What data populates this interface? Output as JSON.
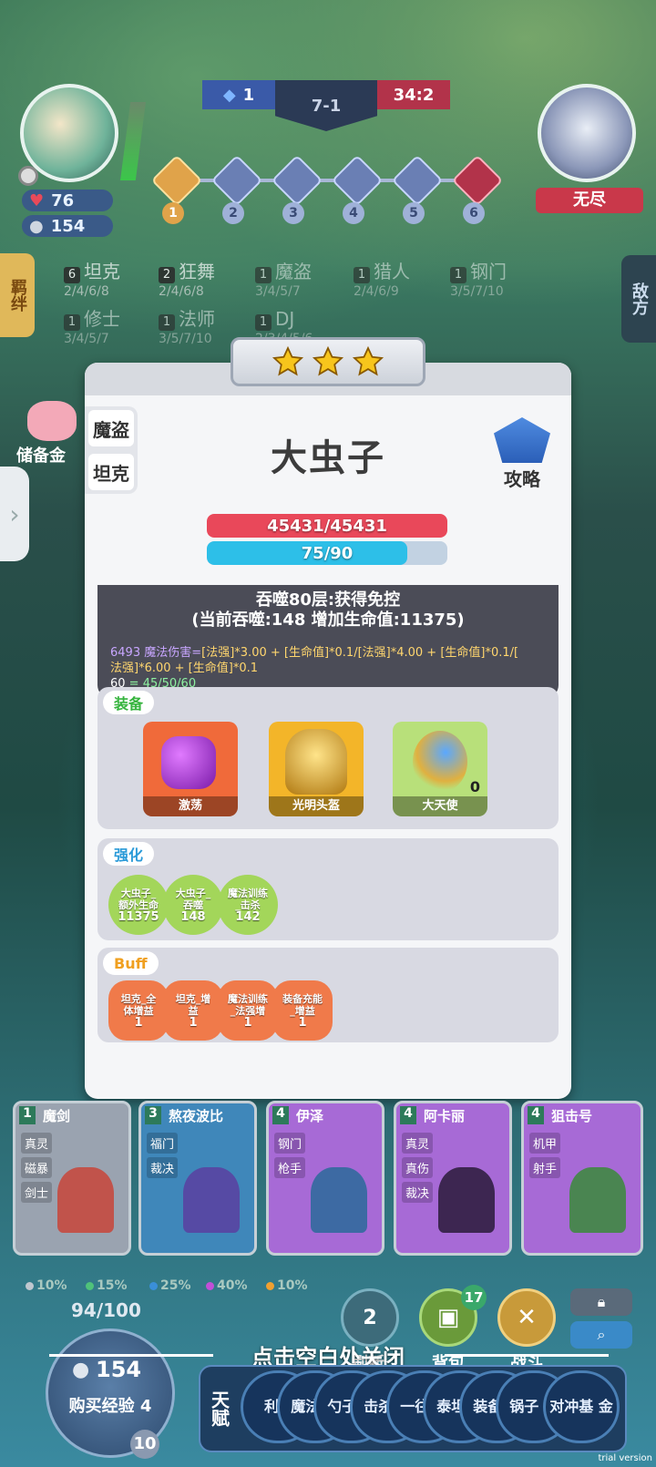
{
  "player": {
    "hp": "76",
    "gold": "154"
  },
  "match": {
    "left_score": "1",
    "round": "7-1",
    "right_score": "34:2"
  },
  "stages": [
    "1",
    "2",
    "3",
    "4",
    "5",
    "6"
  ],
  "opponent": {
    "label": "无尽"
  },
  "side_tabs": {
    "left": "羁绊",
    "right": "敌方"
  },
  "traits": [
    {
      "count": "6",
      "name": "坦克",
      "tiers": "2/4/6/8"
    },
    {
      "count": "2",
      "name": "狂舞",
      "tiers": "2/4/6/8"
    },
    {
      "count": "1",
      "name": "魔盗",
      "tiers": "3/4/5/7"
    },
    {
      "count": "1",
      "name": "猎人",
      "tiers": "2/4/6/9"
    },
    {
      "count": "1",
      "name": "钢门",
      "tiers": "3/5/7/10"
    },
    {
      "count": "1",
      "name": "修士",
      "tiers": "3/4/5/7"
    },
    {
      "count": "1",
      "name": "法师",
      "tiers": "3/5/7/10"
    },
    {
      "count": "1",
      "name": "DJ",
      "tiers": "2/3/4/5/6"
    }
  ],
  "reserve": {
    "label": "储备金"
  },
  "card": {
    "unit_name": "大虫子",
    "traits": [
      "魔盗",
      "坦克"
    ],
    "guide": "攻略",
    "hp_text": "45431/45431",
    "hp_ratio": 1.0,
    "mana_text": "75/90",
    "mana_ratio": 0.833,
    "skill_line1": "吞噬80层:获得免控",
    "skill_line2": "(当前吞噬:148 增加生命值:11375)",
    "formula_dmg": "6493",
    "formula_a": "魔法伤害=",
    "formula_b": "[法强]*3.00 + [生命值]*0.1/[法强]*4.00 + [生命值]*0.1/[",
    "formula_c": "法强]*6.00 + [生命值]*0.1",
    "formula_mana_a": "60",
    "formula_mana_b": " = 45/50/60",
    "sections": {
      "equip_label": "装备",
      "equip": [
        {
          "name": "激荡",
          "color": "#f06a3a"
        },
        {
          "name": "光明头盔",
          "color": "#f3b529"
        },
        {
          "name": "大天使",
          "color": "#b8e07a",
          "count": "0"
        }
      ],
      "enhance_label": "强化",
      "enhance": [
        {
          "l1": "大虫子_",
          "l2": "额外生命",
          "n": "11375"
        },
        {
          "l1": "大虫子_",
          "l2": "吞噬",
          "n": "148"
        },
        {
          "l1": "魔法训练",
          "l2": "_击杀",
          "n": "142"
        }
      ],
      "buff_label": "Buff",
      "buffs": [
        {
          "l1": "坦克_全",
          "l2": "体增益",
          "n": "1"
        },
        {
          "l1": "坦克_增",
          "l2": "益",
          "n": "1"
        },
        {
          "l1": "魔法训练",
          "l2": "_法强增",
          "n": "1"
        },
        {
          "l1": "装备充能",
          "l2": "_增益",
          "n": "1"
        }
      ]
    }
  },
  "shop": [
    {
      "cost": "1",
      "name": "魔剑",
      "tags": [
        "真灵",
        "磁暴",
        "剑士"
      ],
      "bg": "#9aa3b0",
      "fig": "#c8453a"
    },
    {
      "cost": "3",
      "name": "熬夜波比",
      "tags": [
        "福门",
        "裁决"
      ],
      "bg": "#3f87ba",
      "fig": "#5a3fa0"
    },
    {
      "cost": "4",
      "name": "伊泽",
      "tags": [
        "钢门",
        "枪手"
      ],
      "bg": "#a76ad6",
      "fig": "#2a6a9a"
    },
    {
      "cost": "4",
      "name": "阿卡丽",
      "tags": [
        "真灵",
        "真伤",
        "裁决"
      ],
      "bg": "#a76ad6",
      "fig": "#2a1a3a"
    },
    {
      "cost": "4",
      "name": "狙击号",
      "tags": [
        "机甲",
        "射手"
      ],
      "bg": "#a76ad6",
      "fig": "#3a8a3a"
    }
  ],
  "odds": [
    {
      "pct": "10%",
      "color": "#bfc7cf"
    },
    {
      "pct": "15%",
      "color": "#4fc27a"
    },
    {
      "pct": "25%",
      "color": "#3a8fd8"
    },
    {
      "pct": "40%",
      "color": "#c24fd8"
    },
    {
      "pct": "10%",
      "color": "#f0a030"
    }
  ],
  "bottom": {
    "xp": "94/100",
    "gold": "154",
    "buy_xp": "购买经验 4",
    "level": "10",
    "refresh": "刷新",
    "refresh_cost": "2",
    "bag": "背包",
    "bag_count": "17",
    "battle": "战斗",
    "close_hint": "点击空白处关闭",
    "talent_label": "天赋",
    "talents": [
      "利润",
      "魔法 练",
      "勺子 斗",
      "击杀 赢",
      "一往 前",
      "泰坦 化",
      "装备 能",
      "锅子 帅",
      "对冲基 金"
    ],
    "trial": "trial version"
  }
}
